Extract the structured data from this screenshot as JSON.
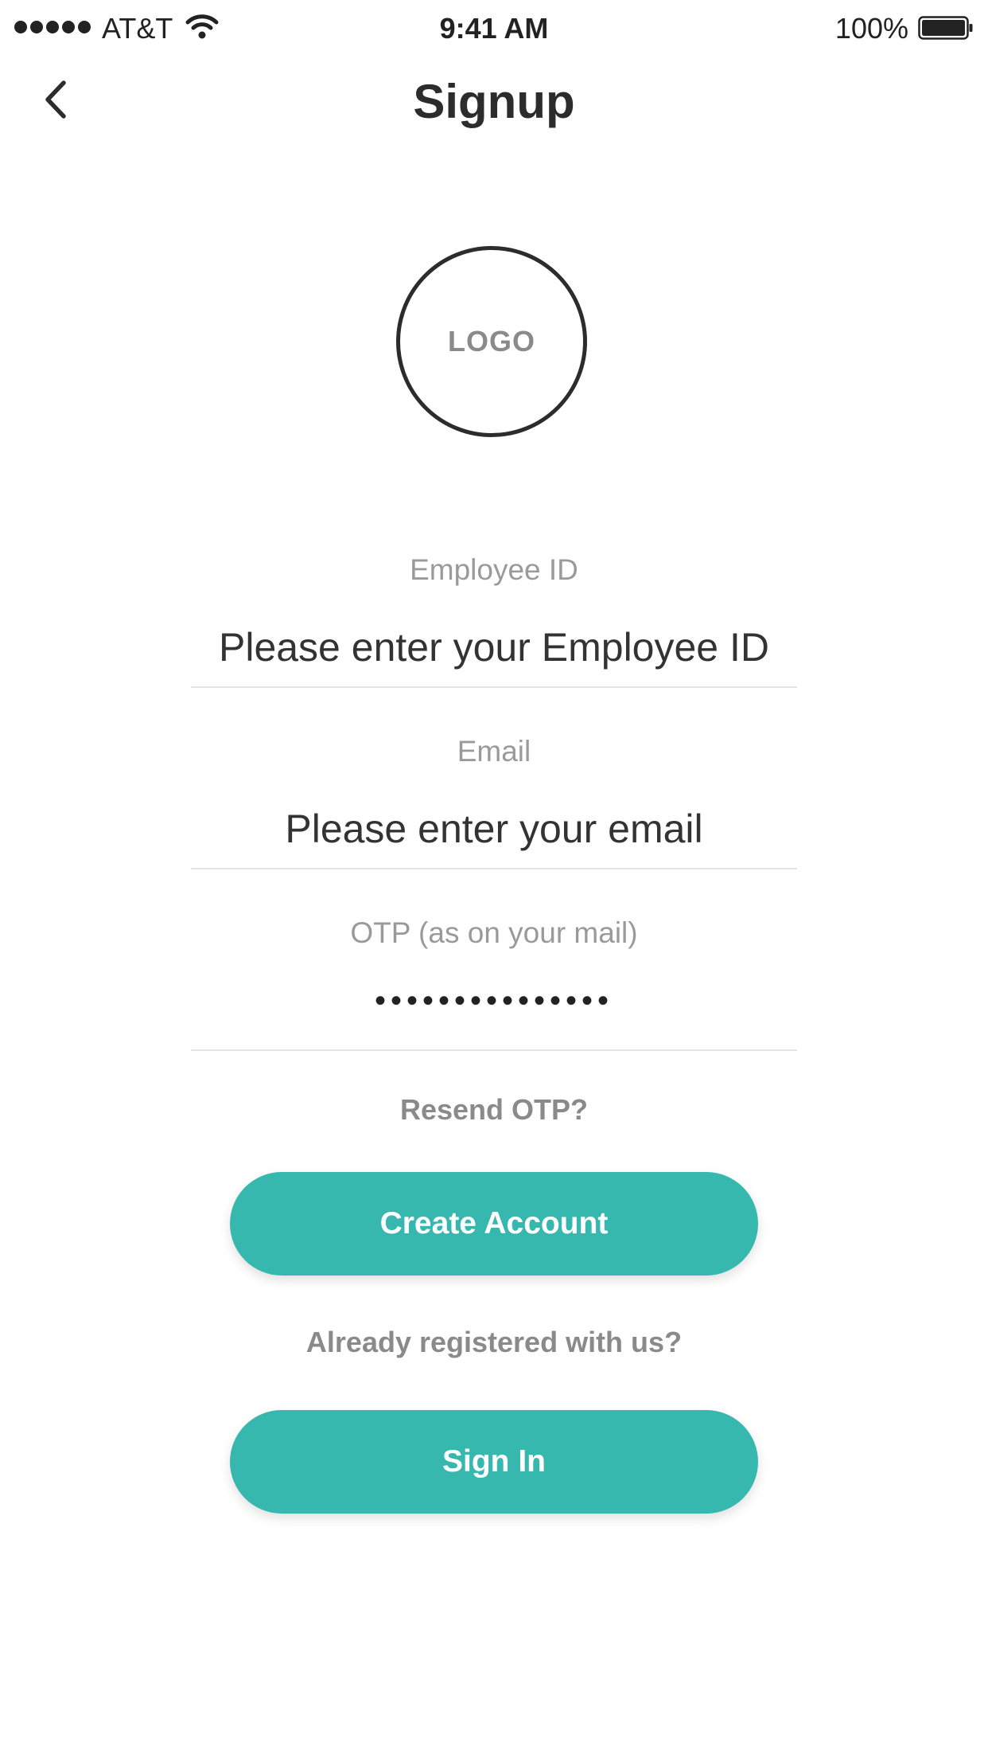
{
  "status_bar": {
    "carrier": "AT&T",
    "time": "9:41 AM",
    "battery": "100%",
    "icons": [
      "signal-dots-icon",
      "wifi-icon",
      "battery-icon"
    ]
  },
  "nav": {
    "title": "Signup",
    "back_icon": "chevron-left-icon"
  },
  "logo": {
    "text": "LOGO"
  },
  "form": {
    "employee_id": {
      "label": "Employee ID",
      "placeholder": "Please enter your Employee ID",
      "value": ""
    },
    "email": {
      "label": "Email",
      "placeholder": "Please enter your email",
      "value": ""
    },
    "otp": {
      "label": "OTP (as on your mail)",
      "value": "123456789012345"
    }
  },
  "actions": {
    "resend_otp": "Resend OTP?",
    "create_account": "Create Account",
    "already_registered": "Already registered with us?",
    "sign_in": "Sign In"
  },
  "colors": {
    "accent": "#37b8af",
    "label": "#9a9a9a",
    "text": "#333333"
  }
}
